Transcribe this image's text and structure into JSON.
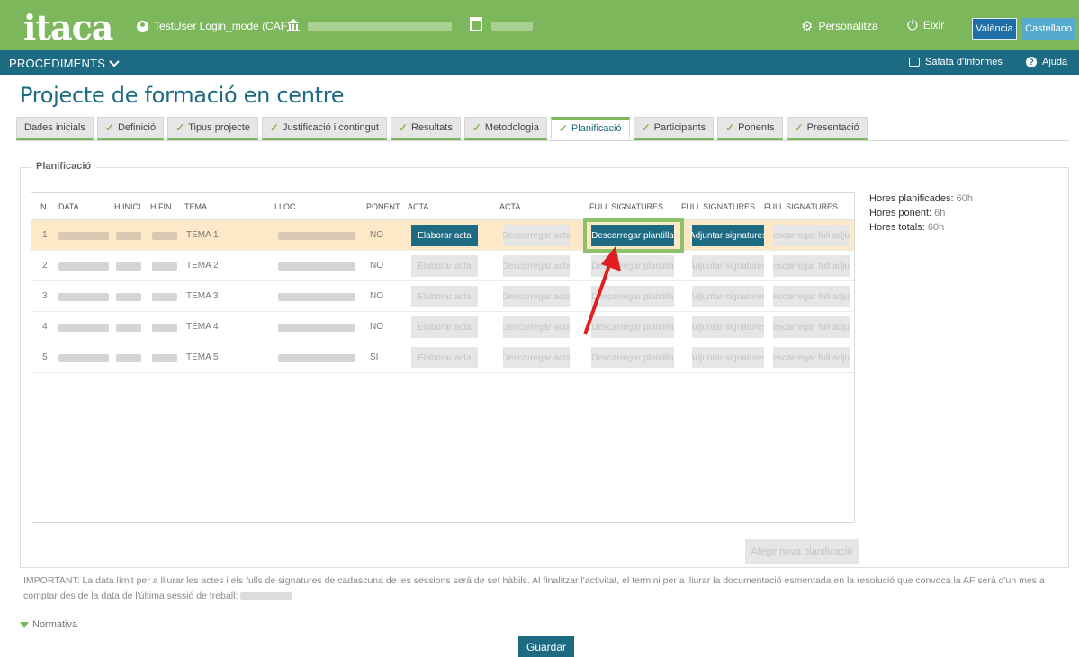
{
  "header": {
    "logo": "itaca",
    "user": "TestUser Login_mode (CAF)",
    "personalitza": "Personalitza",
    "eixir": "Eixir",
    "lang_valencia": "València",
    "lang_castellano": "Castellano"
  },
  "nav": {
    "procediments": "PROCEDIMENTS",
    "safata": "Safata d'Informes",
    "ajuda": "Ajuda"
  },
  "page": {
    "title": "Projecte de formació en centre"
  },
  "tabs": [
    {
      "label": "Dades inicials",
      "check": false
    },
    {
      "label": "Definició",
      "check": true
    },
    {
      "label": "Tipus projecte",
      "check": true
    },
    {
      "label": "Justificació i contingut",
      "check": true
    },
    {
      "label": "Resultats",
      "check": true
    },
    {
      "label": "Metodologia",
      "check": true
    },
    {
      "label": "Planificació",
      "check": true
    },
    {
      "label": "Participants",
      "check": true
    },
    {
      "label": "Ponents",
      "check": true
    },
    {
      "label": "Presentació",
      "check": true
    }
  ],
  "active_tab": "Planificació",
  "section": {
    "legend": "Planificació"
  },
  "table": {
    "headers": {
      "n": "N",
      "data": "DATA",
      "hinici": "H.INICI",
      "hfin": "H.FIN",
      "tema": "TEMA",
      "lloc": "LLOC",
      "ponent": "PONENT",
      "acta1": "ACTA",
      "acta2": "ACTA",
      "full1": "FULL SIGNATURES",
      "full2": "FULL SIGNATURES",
      "full3": "FULL SIGNATURES"
    },
    "buttons": {
      "elaborar": "Elaborar acta",
      "descarregar_acta": "Descarregar acta",
      "descarregar_plantilla": "Descarregar plantilla",
      "adjuntar": "Adjuntar signatures",
      "descarregar_full": "Descarregar full adjunt"
    },
    "rows": [
      {
        "n": "1",
        "tema": "TEMA 1",
        "ponent": "NO"
      },
      {
        "n": "2",
        "tema": "TEMA 2",
        "ponent": "NO"
      },
      {
        "n": "3",
        "tema": "TEMA 3",
        "ponent": "NO"
      },
      {
        "n": "4",
        "tema": "TEMA 4",
        "ponent": "NO"
      },
      {
        "n": "5",
        "tema": "TEMA 5",
        "ponent": "SI"
      }
    ]
  },
  "summary": {
    "hores_planificades_label": "Hores planificades:",
    "hores_planificades_value": "60h",
    "hores_ponent_label": "Hores ponent:",
    "hores_ponent_value": "6h",
    "hores_totals_label": "Hores totals:",
    "hores_totals_value": "60h"
  },
  "afegir": "Afegir nova planificació",
  "important_text": "IMPORTANT: La data límit per a lliurar les actes i els fulls de signatures de cadascuna de les sessions serà de set hàbils. Al finalitzar l'activitat, el termini per a lliurar la documentació esmentada en la resolució que convoca la AF serà d'un mes a comptar des de la data de l'última sessió de treball:",
  "normativa": "Normativa",
  "guardar": "Guardar",
  "colors": {
    "green": "#7db75c",
    "dark_teal": "#1d6a83",
    "highlight_row": "#fde8c8",
    "arrow_red": "#e02020"
  }
}
